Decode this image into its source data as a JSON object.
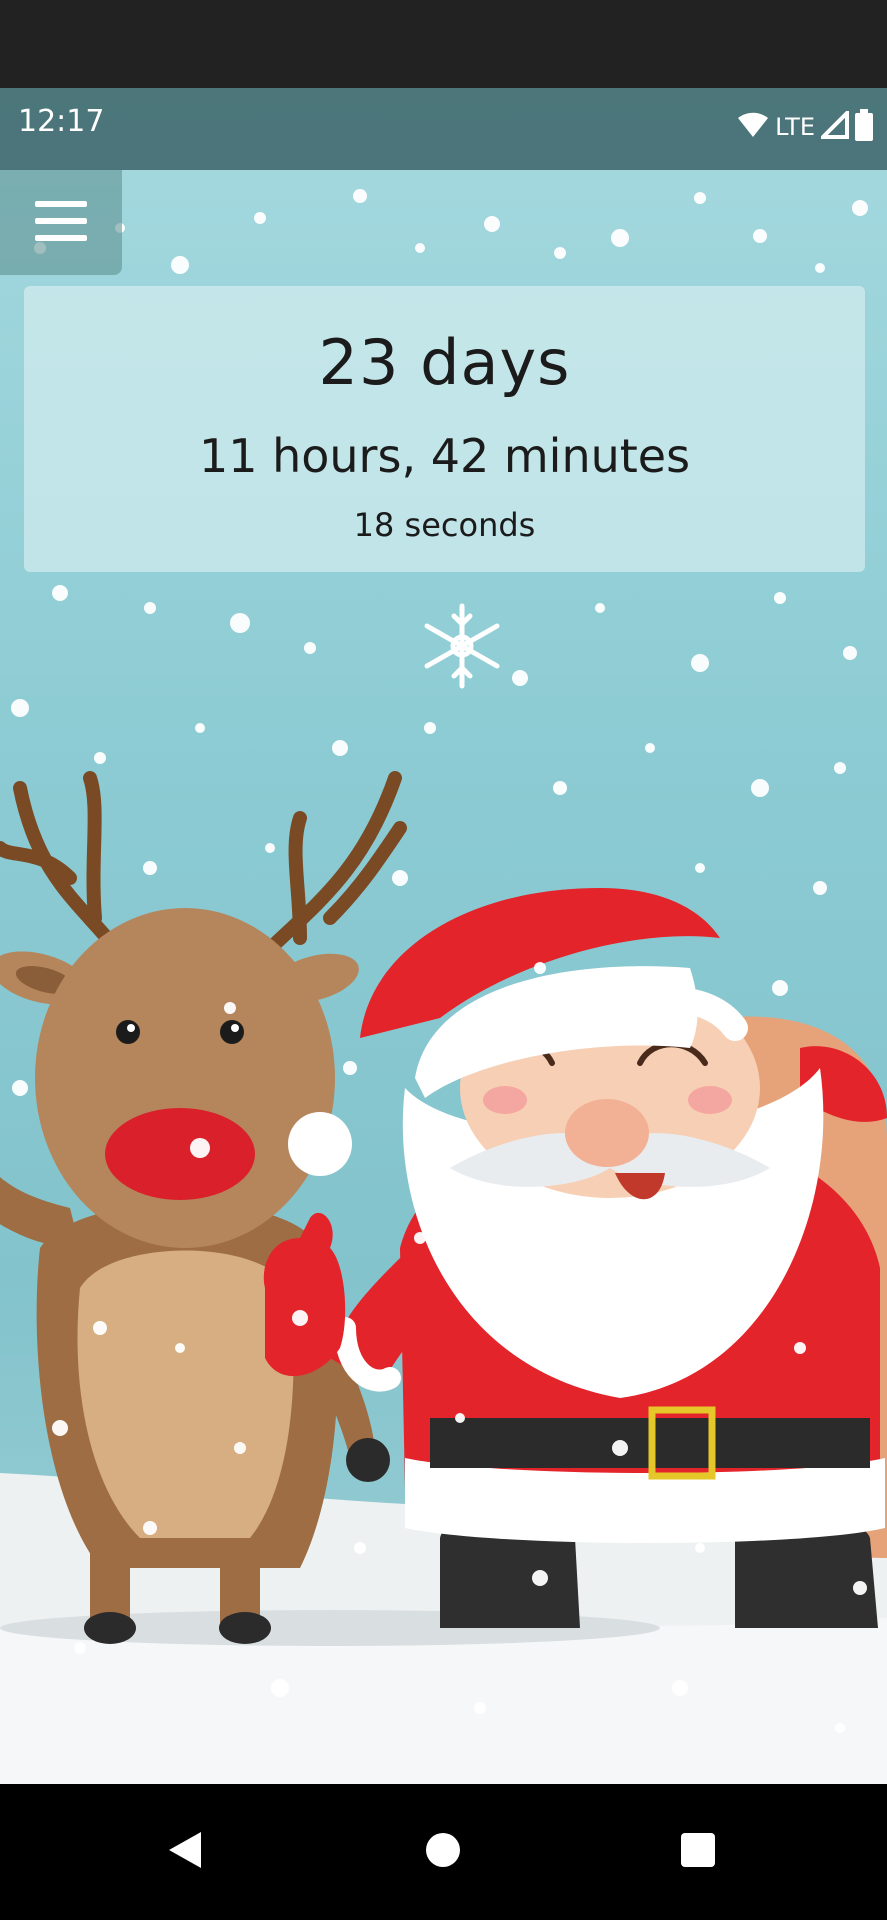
{
  "status_bar": {
    "time": "12:17",
    "network": "LTE",
    "icons": [
      "wifi-icon",
      "signal-icon",
      "battery-icon"
    ]
  },
  "menu": {
    "icon": "hamburger-menu-icon"
  },
  "countdown": {
    "days_value": "23",
    "days_unit": "days",
    "hours_value": "11",
    "hours_unit": "hours,",
    "minutes_value": "42",
    "minutes_unit": "minutes",
    "seconds_value": "18",
    "seconds_unit": "seconds"
  },
  "illustration": {
    "subjects": [
      "reindeer",
      "santa",
      "snowflake",
      "snow"
    ]
  },
  "navigation": {
    "buttons": [
      "back-icon",
      "home-icon",
      "recents-icon"
    ]
  },
  "colors": {
    "sky": "#8ccbd3",
    "santa_red": "#e3242b",
    "reindeer_brown": "#b5865c",
    "snow": "#ffffff"
  }
}
